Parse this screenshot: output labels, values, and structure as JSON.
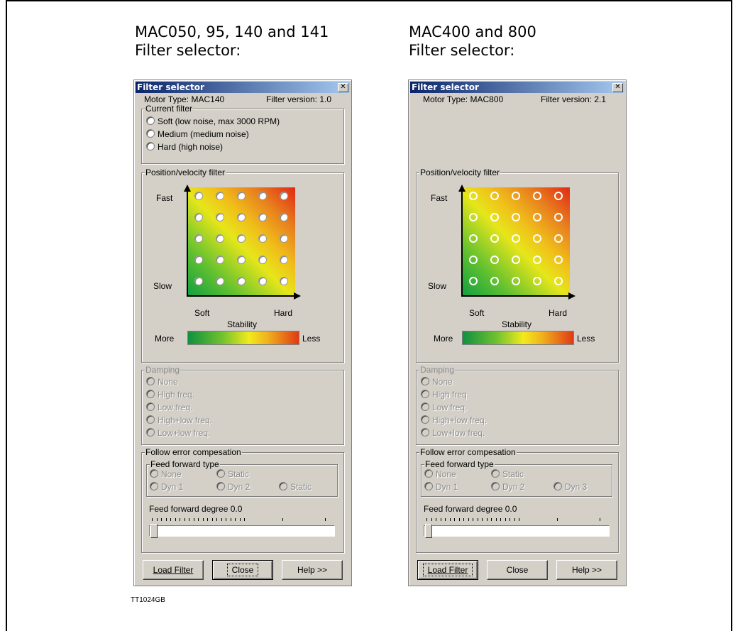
{
  "left_heading": "MAC050, 95, 140 and 141\nFilter selector:",
  "right_heading": "MAC400 and 800\nFilter selector:",
  "figure_id": "TT1024GB",
  "left": {
    "title": "Filter selector",
    "motor_type": "Motor Type:  MAC140",
    "filter_version": "Filter version: 1.0",
    "current_filter": {
      "legend": "Current filter",
      "options": [
        "Soft (low noise, max 3000 RPM)",
        "Medium (medium noise)",
        "Hard (high noise)"
      ]
    },
    "pv": {
      "legend": "Position/velocity filter",
      "fast": "Fast",
      "slow": "Slow",
      "soft": "Soft",
      "hard": "Hard",
      "stability": "Stability",
      "more": "More",
      "less": "Less"
    },
    "damping": {
      "legend": "Damping",
      "options": [
        "None",
        "High freq.",
        "Low freq.",
        "High+low freq.",
        "Low+low freq."
      ]
    },
    "follow": {
      "legend": "Follow error compesation",
      "ff_legend": "Feed forward type",
      "ff_row1": [
        "None",
        "Static"
      ],
      "ff_row2": [
        "Dyn 1",
        "Dyn 2",
        "Static"
      ],
      "degree": "Feed forward degree  0.0",
      "degree_value": 0
    },
    "buttons": {
      "load": "Load Filter",
      "close": "Close",
      "help": "Help >>"
    }
  },
  "right": {
    "title": "Filter selector",
    "motor_type": "Motor Type:  MAC800",
    "filter_version": "Filter version: 2.1",
    "pv": {
      "legend": "Position/velocity filter",
      "fast": "Fast",
      "slow": "Slow",
      "soft": "Soft",
      "hard": "Hard",
      "stability": "Stability",
      "more": "More",
      "less": "Less"
    },
    "damping": {
      "legend": "Damping",
      "options": [
        "None",
        "High freq.",
        "Low freq.",
        "High+low freq.",
        "Low+low freq."
      ]
    },
    "follow": {
      "legend": "Follow error compesation",
      "ff_legend": "Feed forward type",
      "ff_row1": [
        "None",
        "Static"
      ],
      "ff_row2": [
        "Dyn 1",
        "Dyn 2",
        "Dyn 3"
      ],
      "degree": "Feed forward degree  0.0",
      "degree_value": 0
    },
    "buttons": {
      "load": "Load Filter",
      "close": "Close",
      "help": "Help >>"
    }
  },
  "icons": {
    "close": "close-icon",
    "radio": "radio-button"
  }
}
